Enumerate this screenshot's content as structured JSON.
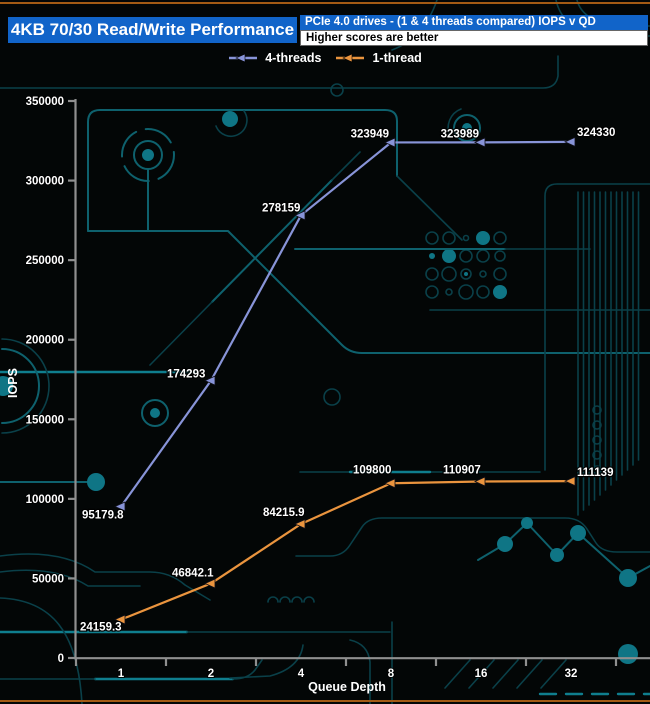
{
  "header": {
    "title": "4KB 70/30 Read/Write Performance",
    "subtitle": "PCIe 4.0 drives - (1 & 4 threads compared) IOPS v QD",
    "note": "Higher scores are better"
  },
  "legend": [
    {
      "label": "4-threads",
      "color": "#8894d8"
    },
    {
      "label": "1-thread",
      "color": "#ea943e"
    }
  ],
  "chart_data": {
    "type": "line",
    "title": "4KB 70/30 Read/Write Performance",
    "subtitle": "PCIe 4.0 drives - (1 & 4 threads compared) IOPS v QD",
    "note": "Higher scores are better",
    "x": [
      1,
      2,
      4,
      8,
      16,
      32
    ],
    "categories": [
      "1",
      "2",
      "4",
      "8",
      "16",
      "32"
    ],
    "x_scale": "log2-category",
    "series": [
      {
        "name": "4-threads",
        "color": "#8894d8",
        "values": [
          95179.8,
          174293,
          278159,
          323949,
          323989,
          324330
        ],
        "labels": [
          "95179.8",
          "174293",
          "278159",
          "323949",
          "323989",
          "324330"
        ]
      },
      {
        "name": "1-thread",
        "color": "#ea943e",
        "values": [
          24159.3,
          46842.1,
          84215.9,
          109800,
          110907,
          111139
        ],
        "labels": [
          "24159.3",
          "46842.1",
          "84215.9",
          "109800",
          "110907",
          "111139"
        ]
      }
    ],
    "xlabel": "Queue Depth",
    "ylabel": "IOPS",
    "ylim": [
      0,
      350000
    ],
    "ytick_step": 50000,
    "yticks": [
      "0",
      "50000",
      "100000",
      "150000",
      "200000",
      "250000",
      "300000",
      "350000"
    ],
    "grid": false,
    "legend_position": "top-center",
    "marker": "left-arrow"
  },
  "colors": {
    "header_blue": "#1164c9",
    "accent_orange_rule": "#a35a14",
    "axis_gray": "#8f8f8f",
    "background": "#030606",
    "circuit_dim": "#0a4049",
    "circuit_mid": "#0e616d",
    "circuit_bright": "#0f7e8e",
    "circuit_fill": "#0f7585",
    "label_text": "#ffffff"
  }
}
